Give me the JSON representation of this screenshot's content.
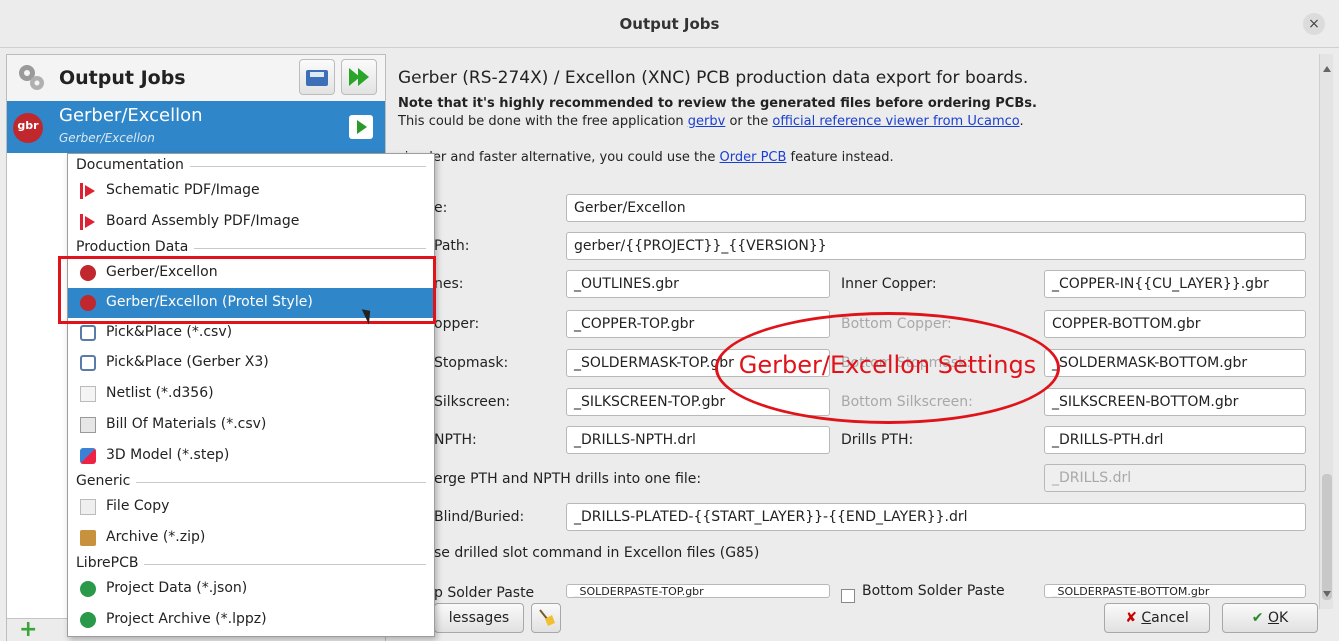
{
  "window": {
    "title": "Output Jobs",
    "close_symbol": "×"
  },
  "left_pane": {
    "heading": "Output Jobs",
    "selected_job": {
      "name": "Gerber/Excellon",
      "type": "Gerber/Excellon",
      "badge": "gbr"
    }
  },
  "menu": {
    "sections": {
      "documentation": "Documentation",
      "production": "Production Data",
      "generic": "Generic",
      "librepcb": "LibrePCB"
    },
    "items": {
      "schematic": "Schematic PDF/Image",
      "board_assembly": "Board Assembly PDF/Image",
      "gerber": "Gerber/Excellon",
      "gerber_protel": "Gerber/Excellon (Protel Style)",
      "pnp_csv": "Pick&Place (*.csv)",
      "pnp_x3": "Pick&Place (Gerber X3)",
      "netlist": "Netlist (*.d356)",
      "bom": "Bill Of Materials (*.csv)",
      "model3d": "3D Model (*.step)",
      "file_copy": "File Copy",
      "archive": "Archive (*.zip)",
      "project_data": "Project Data (*.json)",
      "project_archive": "Project Archive (*.lppz)"
    }
  },
  "description": {
    "title": "Gerber (RS-274X) / Excellon (XNC) PCB production data export for boards.",
    "note": "Note that it's highly recommended to review the generated files before ordering PCBs.",
    "note2_prefix": "This could be done with the free application ",
    "link_gerbv": "gerbv",
    "note2_mid": " or the ",
    "link_ucamco": "official reference viewer from Ucamco",
    "note2_suffix": ".",
    "alt_prefix": "simpler and faster alternative, you could use the ",
    "link_order": "Order PCB",
    "alt_suffix": " feature instead."
  },
  "settings": {
    "name_label": "e:",
    "name_value": "Gerber/Excellon",
    "path_label": "Path:",
    "path_value": "gerber/{{PROJECT}}_{{VERSION}}",
    "outlines_label": "nes:",
    "outlines_value": "_OUTLINES.gbr",
    "inner_copper_label": "Inner Copper:",
    "inner_copper_value": "_COPPER-IN{{CU_LAYER}}.gbr",
    "top_copper_label": "opper:",
    "top_copper_value": "_COPPER-TOP.gbr",
    "bottom_copper_label": "Bottom Copper:",
    "bottom_copper_value": "COPPER-BOTTOM.gbr",
    "top_soldermask_label": "Stopmask:",
    "top_soldermask_value": "_SOLDERMASK-TOP.gbr",
    "bottom_soldermask_label": "Bottom Stopmask:",
    "bottom_soldermask_value": "_SOLDERMASK-BOTTOM.gbr",
    "top_silk_label": "Silkscreen:",
    "top_silk_value": "_SILKSCREEN-TOP.gbr",
    "bottom_silk_label": "Bottom Silkscreen:",
    "bottom_silk_value": "_SILKSCREEN-BOTTOM.gbr",
    "npth_label": "NPTH:",
    "npth_value": "_DRILLS-NPTH.drl",
    "pth_label": "Drills PTH:",
    "pth_value": "_DRILLS-PTH.drl",
    "merge_label": "erge PTH and NPTH drills into one file:",
    "merged_value": "_DRILLS.drl",
    "blind_label": "Blind/Buried:",
    "blind_value": "_DRILLS-PLATED-{{START_LAYER}}-{{END_LAYER}}.drl",
    "g85_label": "se drilled slot command in Excellon files (G85)",
    "top_paste_label": "p Solder Paste",
    "top_paste_value": "_SOLDERPASTE-TOP.gbr",
    "bottom_paste_label": "Bottom Solder Paste",
    "bottom_paste_value": "_SOLDERPASTE-BOTTOM.gbr"
  },
  "annotation": {
    "text": "Gerber/Excellon Settings"
  },
  "buttons": {
    "messages": "Messages",
    "messages_visible": "lessages",
    "cancel_pre": "",
    "cancel_u": "C",
    "cancel_post": "ancel",
    "ok_u": "O",
    "ok_post": "K"
  },
  "colors": {
    "selection": "#2f86c8",
    "annotation_red": "#e0131a",
    "link": "#1a3fd0"
  }
}
